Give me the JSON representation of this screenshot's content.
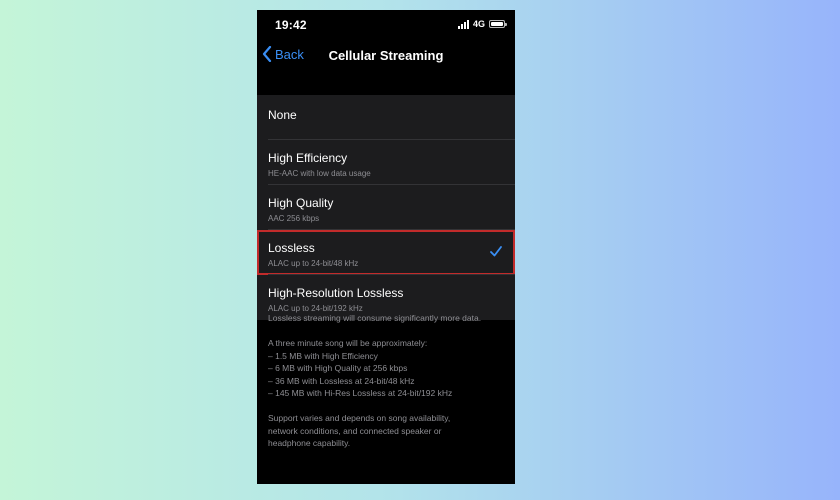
{
  "status": {
    "time": "19:42",
    "network": "4G"
  },
  "nav": {
    "back_label": "Back",
    "title": "Cellular Streaming"
  },
  "options": [
    {
      "title": "None",
      "subtitle": "",
      "selected": false
    },
    {
      "title": "High Efficiency",
      "subtitle": "HE-AAC with low data usage",
      "selected": false
    },
    {
      "title": "High Quality",
      "subtitle": "AAC 256 kbps",
      "selected": false
    },
    {
      "title": "Lossless",
      "subtitle": "ALAC up to 24-bit/48 kHz",
      "selected": true
    },
    {
      "title": "High-Resolution Lossless",
      "subtitle": "ALAC up to 24-bit/192 kHz",
      "selected": false
    }
  ],
  "footer": {
    "warning": "Lossless streaming will consume significantly more data.",
    "intro": "A three minute song will be approximately:",
    "estimates": [
      "– 1.5 MB with High Efficiency",
      "– 6 MB with High Quality at 256 kbps",
      "– 36 MB with Lossless at 24-bit/48 kHz",
      "– 145 MB with Hi-Res Lossless at 24-bit/192 kHz"
    ],
    "support_lines": [
      "Support varies and depends on song availability,",
      "network conditions, and connected speaker or",
      "headphone capability."
    ]
  },
  "colors": {
    "accent": "#3a8ff5",
    "selection_outline": "#c22b2b",
    "background_left": "#c4f5d8",
    "background_right": "#97b4fb"
  },
  "icons": {
    "back": "chevron-left-icon",
    "selected": "checkmark-icon",
    "signal": "cellular-signal-icon",
    "battery": "battery-icon"
  }
}
